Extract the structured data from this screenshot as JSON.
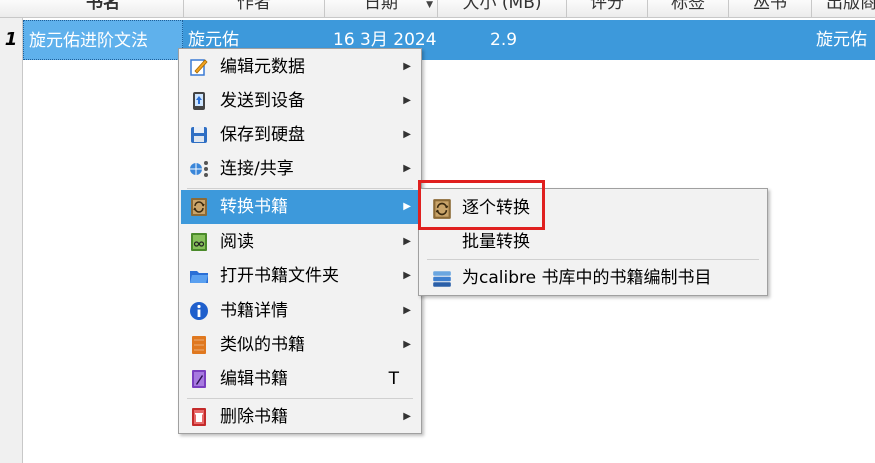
{
  "table": {
    "headers": {
      "title": "书名",
      "author": "作者",
      "date": "日期",
      "size": "大小 (MB)",
      "rating": "评分",
      "tags": "标签",
      "series": "丛书",
      "publisher": "出版商"
    },
    "sort_indicator": "▼",
    "rows": [
      {
        "number": "1",
        "title": "旋元佑进阶文法",
        "author": "旋元佑",
        "date": "16 3月 2024",
        "size": "2.9",
        "publisher": "旋元佑"
      }
    ]
  },
  "context_menu": {
    "items": [
      {
        "label": "编辑元数据",
        "icon": "edit-metadata-icon",
        "submenu": true
      },
      {
        "label": "发送到设备",
        "icon": "send-to-device-icon",
        "submenu": true
      },
      {
        "label": "保存到硬盘",
        "icon": "save-disk-icon",
        "submenu": true
      },
      {
        "label": "连接/共享",
        "icon": "connect-share-icon",
        "submenu": true
      },
      {
        "label": "转换书籍",
        "icon": "convert-books-icon",
        "submenu": true,
        "active": true
      },
      {
        "label": "阅读",
        "icon": "read-icon",
        "submenu": true
      },
      {
        "label": "打开书籍文件夹",
        "icon": "open-folder-icon",
        "submenu": true
      },
      {
        "label": "书籍详情",
        "icon": "info-icon",
        "submenu": true
      },
      {
        "label": "类似的书籍",
        "icon": "similar-books-icon",
        "submenu": true
      },
      {
        "label": "编辑书籍",
        "icon": "edit-book-icon",
        "shortcut": "T"
      },
      {
        "label": "删除书籍",
        "icon": "delete-icon",
        "submenu": true
      }
    ],
    "submenu_arrow": "▶"
  },
  "convert_submenu": {
    "items": [
      {
        "label": "逐个转换",
        "icon": "convert-individually-icon"
      },
      {
        "label": "批量转换",
        "icon": ""
      },
      {
        "label": "为calibre 书库中的书籍编制书目",
        "icon": "catalog-icon"
      }
    ]
  },
  "colors": {
    "selection": "#3d99db",
    "highlight_box": "#e0201f"
  }
}
